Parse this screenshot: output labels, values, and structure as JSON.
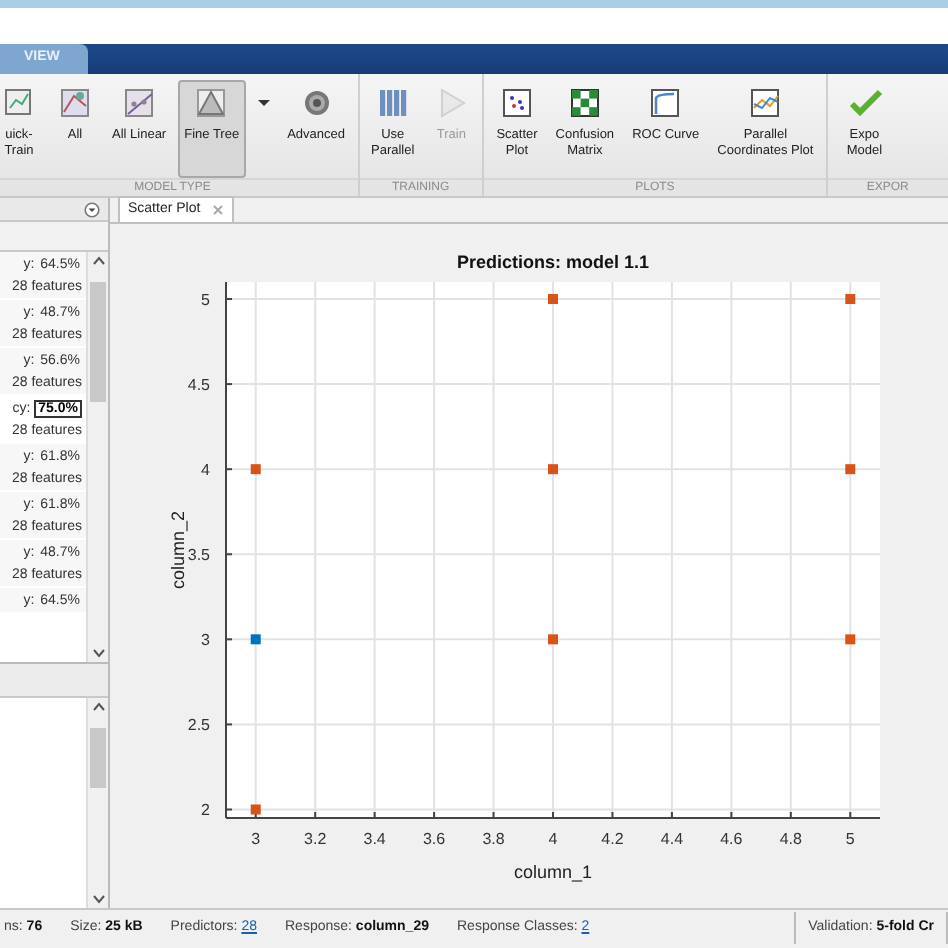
{
  "tabs": [
    {
      "label": "VIEW",
      "selected": true
    }
  ],
  "ribbon": {
    "sections": [
      {
        "label": "MODEL TYPE",
        "buttons": [
          {
            "kind": "button",
            "lines": [
              "uick-",
              "Train"
            ],
            "selected": false,
            "disabled": false
          },
          {
            "kind": "button",
            "lines": [
              "All"
            ],
            "selected": false,
            "disabled": false
          },
          {
            "kind": "button",
            "lines": [
              "All Linear"
            ],
            "selected": false,
            "disabled": false
          },
          {
            "kind": "button",
            "lines": [
              "Fine Tree"
            ],
            "selected": true,
            "disabled": false
          },
          {
            "kind": "dropdown",
            "selected": false,
            "disabled": false
          },
          {
            "kind": "button",
            "lines": [
              "Advanced"
            ],
            "selected": false,
            "disabled": false
          }
        ]
      },
      {
        "label": "TRAINING",
        "buttons": [
          {
            "kind": "button",
            "lines": [
              "Use",
              "Parallel"
            ],
            "selected": false,
            "disabled": false
          },
          {
            "kind": "button",
            "lines": [
              "Train"
            ],
            "selected": false,
            "disabled": true
          }
        ]
      },
      {
        "label": "PLOTS",
        "buttons": [
          {
            "kind": "button",
            "lines": [
              "Scatter",
              "Plot"
            ],
            "selected": false,
            "disabled": false
          },
          {
            "kind": "button",
            "lines": [
              "Confusion",
              "Matrix"
            ],
            "selected": false,
            "disabled": false
          },
          {
            "kind": "button",
            "lines": [
              "ROC Curve"
            ],
            "selected": false,
            "disabled": false
          },
          {
            "kind": "button",
            "lines": [
              "Parallel",
              "Coordinates Plot"
            ],
            "selected": false,
            "disabled": false
          }
        ]
      },
      {
        "label": "EXPOR",
        "buttons": [
          {
            "kind": "button",
            "lines": [
              "Expo",
              "Model"
            ],
            "selected": false,
            "disabled": false
          }
        ]
      }
    ]
  },
  "models": [
    {
      "prefix": "y:",
      "accuracy": "64.5%",
      "features": "28 features",
      "selected": false
    },
    {
      "prefix": "y:",
      "accuracy": "48.7%",
      "features": "28 features",
      "selected": false
    },
    {
      "prefix": "y:",
      "accuracy": "56.6%",
      "features": "28 features",
      "selected": false
    },
    {
      "prefix": "cy:",
      "accuracy": "75.0%",
      "features": "28 features",
      "selected": true
    },
    {
      "prefix": "y:",
      "accuracy": "61.8%",
      "features": "28 features",
      "selected": false
    },
    {
      "prefix": "y:",
      "accuracy": "61.8%",
      "features": "28 features",
      "selected": false
    },
    {
      "prefix": "y:",
      "accuracy": "48.7%",
      "features": "28 features",
      "selected": false
    },
    {
      "prefix": "y:",
      "accuracy": "64.5%",
      "selected": false
    }
  ],
  "plot_tabs": [
    {
      "label": "Scatter Plot",
      "selected": true
    }
  ],
  "plot": {
    "chart_data": {
      "type": "scatter",
      "title": "Predictions: model 1.1",
      "xlabel": "column_1",
      "ylabel": "column_2",
      "grid": true,
      "xlim": [
        2.9,
        5.1
      ],
      "ylim": [
        1.95,
        5.1
      ],
      "xticks": [
        {
          "value": 3,
          "label": "3"
        },
        {
          "value": 3.2,
          "label": "3.2"
        },
        {
          "value": 3.4,
          "label": "3.4"
        },
        {
          "value": 3.6,
          "label": "3.6"
        },
        {
          "value": 3.8,
          "label": "3.8"
        },
        {
          "value": 4,
          "label": "4"
        },
        {
          "value": 4.2,
          "label": "4.2"
        },
        {
          "value": 4.4,
          "label": "4.4"
        },
        {
          "value": 4.6,
          "label": "4.6"
        },
        {
          "value": 4.8,
          "label": "4.8"
        },
        {
          "value": 5,
          "label": "5"
        }
      ],
      "yticks": [
        {
          "value": 2,
          "label": "2"
        },
        {
          "value": 2.5,
          "label": "2.5"
        },
        {
          "value": 3,
          "label": "3"
        },
        {
          "value": 3.5,
          "label": "3.5"
        },
        {
          "value": 4,
          "label": "4"
        },
        {
          "value": 4.5,
          "label": "4.5"
        },
        {
          "value": 5,
          "label": "5"
        }
      ],
      "series": [
        {
          "color": "#d95319",
          "x": [
            4,
            5,
            3,
            4,
            5,
            4,
            5,
            3
          ],
          "values": [
            5,
            5,
            4,
            4,
            4,
            3,
            3,
            2
          ]
        },
        {
          "color": "#0072bd",
          "x": [
            3
          ],
          "values": [
            3
          ]
        }
      ]
    }
  },
  "status_bar": [
    {
      "label": "ns:",
      "value": "76",
      "kind": "bold"
    },
    {
      "label": "Size:",
      "value": "25 kB",
      "kind": "bold"
    },
    {
      "label": "Predictors:",
      "value": "28",
      "kind": "link"
    },
    {
      "label": "Response:",
      "value": "column_29",
      "kind": "bold"
    },
    {
      "label": "Response Classes:",
      "value": "2",
      "kind": "link"
    },
    {
      "label": "Validation:",
      "value": "5-fold Cr",
      "kind": "bold"
    }
  ]
}
